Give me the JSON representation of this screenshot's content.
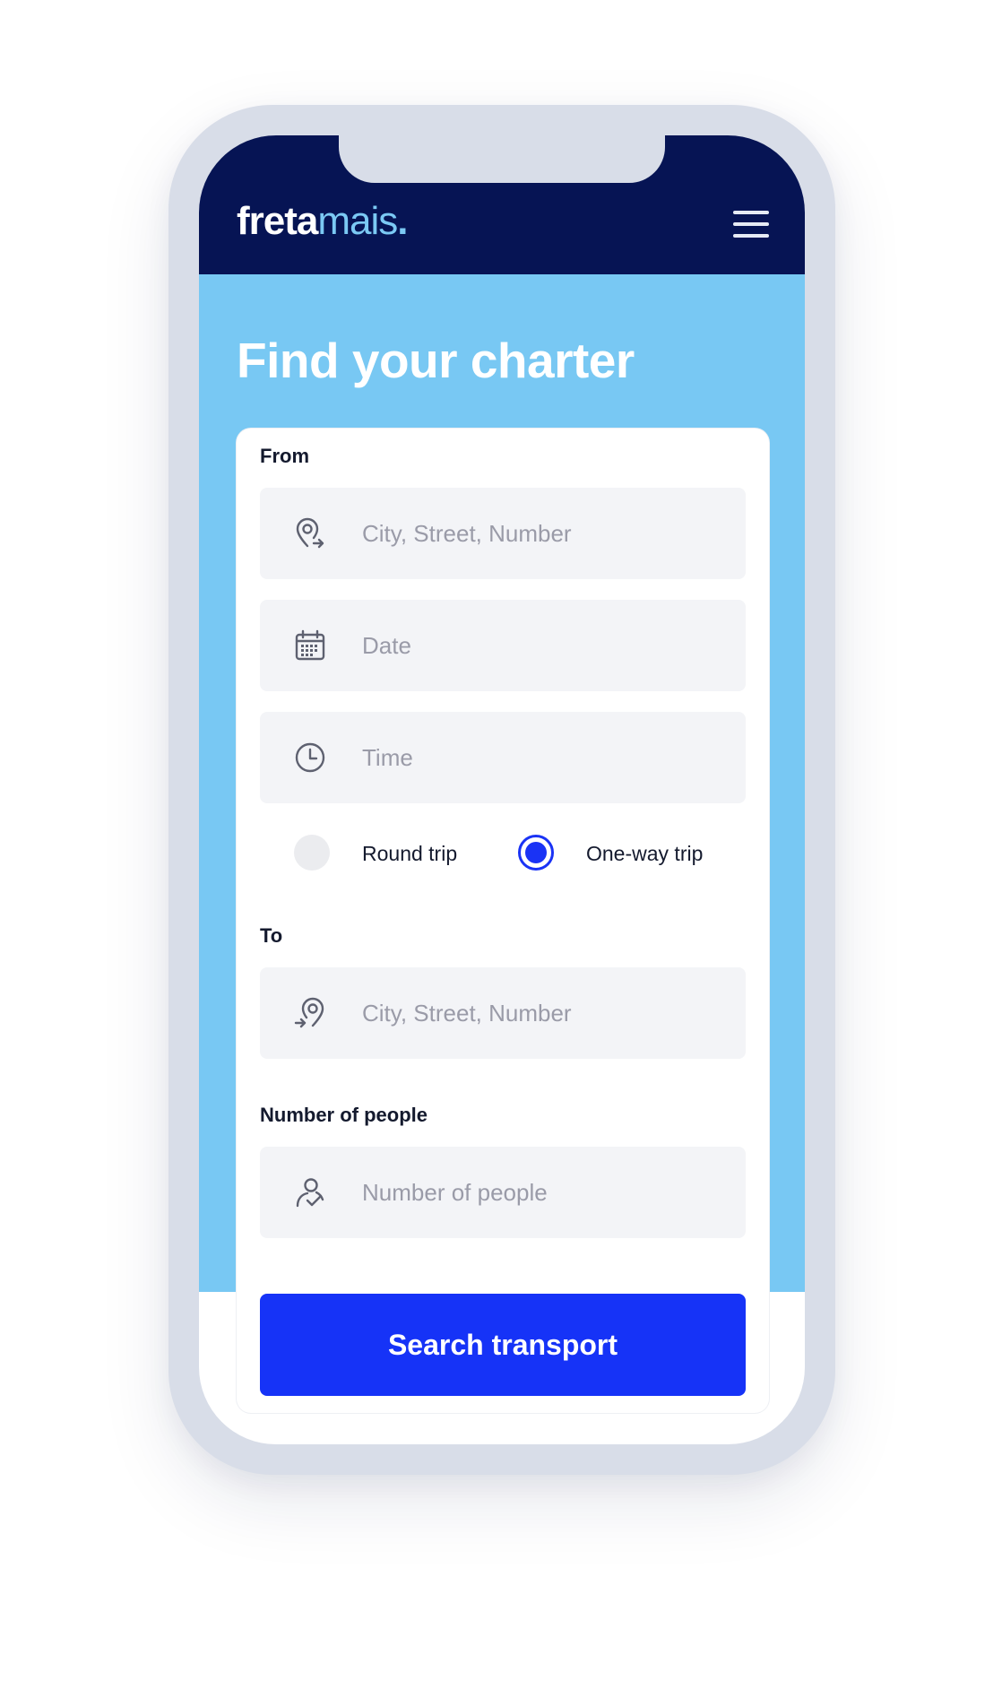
{
  "app": {
    "logo": {
      "part1": "freta",
      "part2": "mais",
      "dot": "."
    }
  },
  "hero": {
    "title": "Find your charter"
  },
  "form": {
    "from_label": "From",
    "from_placeholder": "City, Street, Number",
    "date_placeholder": "Date",
    "time_placeholder": "Time",
    "trip_options": [
      {
        "label": "Round trip",
        "selected": false
      },
      {
        "label": "One-way trip",
        "selected": true
      }
    ],
    "to_label": "To",
    "to_placeholder": "City, Street, Number",
    "people_label": "Number of people",
    "people_placeholder": "Number of people",
    "submit_label": "Search transport"
  },
  "colors": {
    "header_bg": "#061454",
    "hero_bg": "#78c8f3",
    "accent": "#1633f7",
    "field_bg": "#f3f4f7",
    "frame": "#d8dde8"
  },
  "icons": [
    "menu-icon",
    "pin-from-icon",
    "calendar-icon",
    "clock-icon",
    "pin-to-icon",
    "people-icon"
  ]
}
